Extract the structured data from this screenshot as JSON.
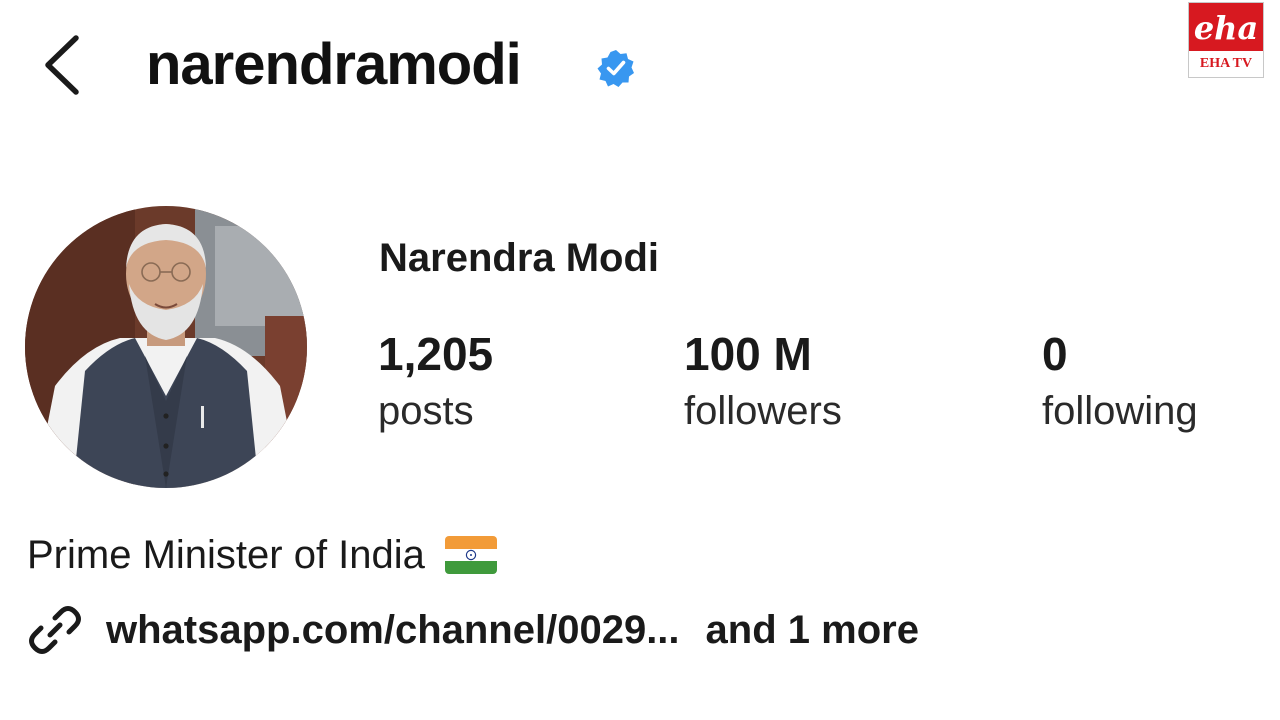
{
  "header": {
    "username": "narendramodi",
    "verified": true
  },
  "watermark": {
    "logo_text": "eha",
    "caption": "EHA TV",
    "color": "#d71920"
  },
  "profile": {
    "display_name": "Narendra Modi",
    "stats": [
      {
        "value": "1,205",
        "label": "posts"
      },
      {
        "value": "100 M",
        "label": "followers"
      },
      {
        "value": "0",
        "label": "following"
      }
    ],
    "bio": "Prime Minister of India",
    "bio_emoji_icon": "india-flag-icon",
    "link_text": "whatsapp.com/channel/0029...",
    "link_more": "and 1 more"
  },
  "colors": {
    "verified_blue": "#3897f0",
    "text": "#1a1a1a"
  }
}
